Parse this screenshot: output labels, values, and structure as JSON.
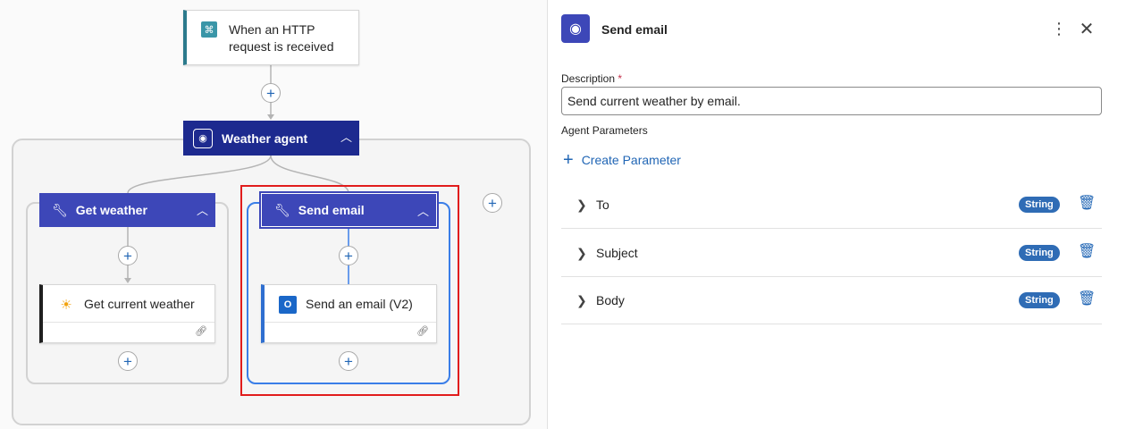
{
  "canvas": {
    "trigger": {
      "label": "When an HTTP request is received",
      "icon": "http-trigger-icon"
    },
    "agent": {
      "title": "Weather agent",
      "icon": "bot-icon",
      "collapse_icon": "chevron-up-icon"
    },
    "tools": [
      {
        "title": "Get weather",
        "icon": "wrench-icon",
        "action": {
          "label": "Get current weather",
          "icon": "sun-icon"
        }
      },
      {
        "title": "Send email",
        "icon": "wrench-icon",
        "action": {
          "label": "Send an email (V2)",
          "icon": "outlook-icon"
        }
      }
    ],
    "add_icon": "+"
  },
  "panel": {
    "title": "Send email",
    "icon": "bot-icon",
    "description": {
      "label": "Description",
      "required_mark": "*",
      "value": "Send current weather by email."
    },
    "agent_parameters_label": "Agent Parameters",
    "create_parameter_label": "Create Parameter",
    "parameters": [
      {
        "name": "To",
        "type": "String"
      },
      {
        "name": "Subject",
        "type": "String"
      },
      {
        "name": "Body",
        "type": "String"
      }
    ]
  },
  "colors": {
    "agent_header": "#1d2a8f",
    "tool_header": "#3d47b8",
    "selection_outline": "#e11c1c",
    "accent_blue": "#2166b5",
    "badge": "#2f6cb5"
  }
}
